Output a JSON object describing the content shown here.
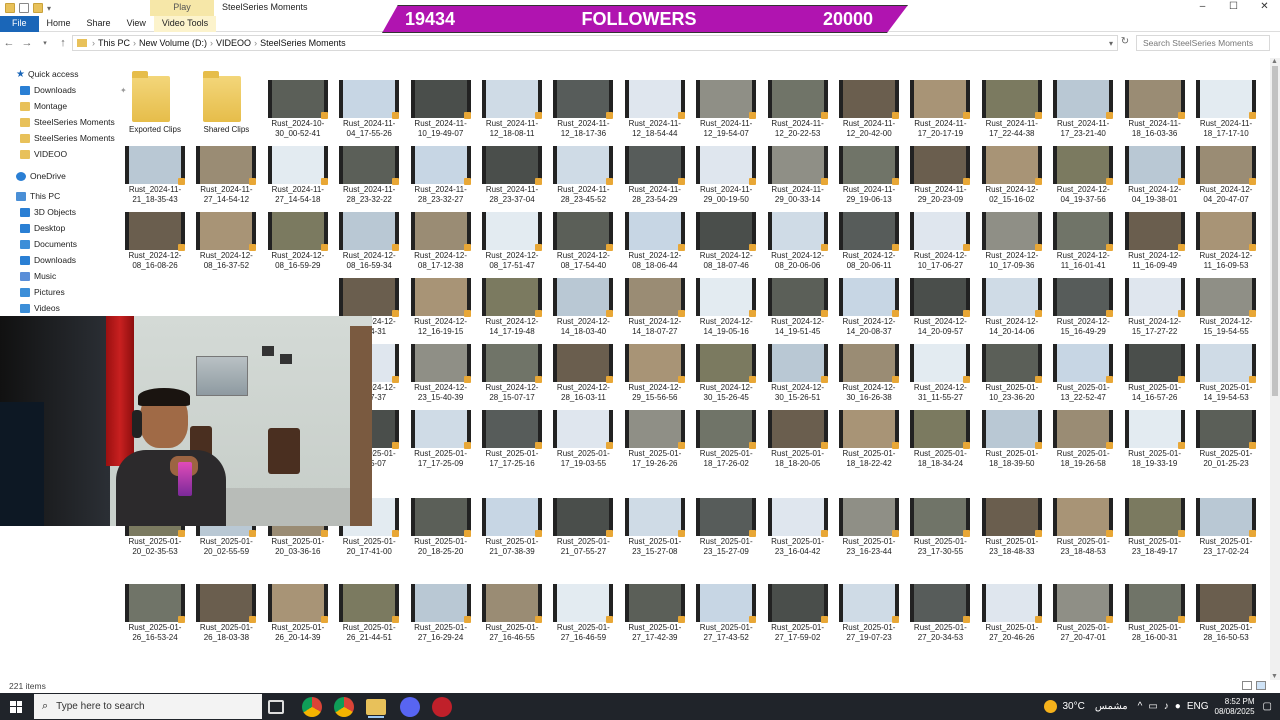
{
  "window": {
    "title": "SteelSeries Moments",
    "context_tab": "Play",
    "controls": [
      "–",
      "☐",
      "✕"
    ]
  },
  "ribbon": {
    "tabs": [
      "File",
      "Home",
      "Share",
      "View",
      "Video Tools"
    ]
  },
  "banner": {
    "current": "19434",
    "label": "FOLLOWERS",
    "goal": "20000",
    "color": "#b014b0"
  },
  "address": {
    "crumbs": [
      "This PC",
      "New Volume (D:)",
      "VIDEOO",
      "SteelSeries Moments"
    ],
    "search_placeholder": "Search SteelSeries Moments"
  },
  "sidebar": {
    "items": [
      {
        "label": "Quick access",
        "icon": "star-icon"
      },
      {
        "label": "Downloads",
        "icon": "download-icon",
        "pinned": true
      },
      {
        "label": "Montage",
        "icon": "folder-icon"
      },
      {
        "label": "SteelSeries Moments",
        "icon": "folder-icon"
      },
      {
        "label": "SteelSeries Moments",
        "icon": "folder-icon"
      },
      {
        "label": "VIDEOO",
        "icon": "folder-icon"
      },
      {
        "label": "OneDrive",
        "icon": "cloud-icon"
      },
      {
        "label": "This PC",
        "icon": "computer-icon"
      },
      {
        "label": "3D Objects",
        "icon": "cube-icon"
      },
      {
        "label": "Desktop",
        "icon": "desktop-icon"
      },
      {
        "label": "Documents",
        "icon": "documents-icon"
      },
      {
        "label": "Downloads",
        "icon": "download-icon"
      },
      {
        "label": "Music",
        "icon": "music-icon"
      },
      {
        "label": "Pictures",
        "icon": "pictures-icon"
      },
      {
        "label": "Videos",
        "icon": "videos-icon"
      }
    ]
  },
  "files": {
    "folders": [
      "Exported Clips",
      "Shared Clips"
    ],
    "rows": [
      [
        "Rust_2024-10-30_00-52-41",
        "Rust_2024-11-04_17-55-26",
        "Rust_2024-11-10_19-49-07",
        "Rust_2024-11-12_18-08-11",
        "Rust_2024-11-12_18-17-36",
        "Rust_2024-11-12_18-54-44",
        "Rust_2024-11-12_19-54-07",
        "Rust_2024-11-12_20-22-53",
        "Rust_2024-11-12_20-42-00",
        "Rust_2024-11-17_20-17-19",
        "Rust_2024-11-17_22-44-38",
        "Rust_2024-11-17_23-21-40",
        "Rust_2024-11-18_16-03-36",
        "Rust_2024-11-18_17-17-10"
      ],
      [
        "Rust_2024-11-21_18-35-43",
        "Rust_2024-11-27_14-54-12",
        "Rust_2024-11-27_14-54-18",
        "Rust_2024-11-28_23-32-22",
        "Rust_2024-11-28_23-32-27",
        "Rust_2024-11-28_23-37-04",
        "Rust_2024-11-28_23-45-52",
        "Rust_2024-11-28_23-54-29",
        "Rust_2024-11-29_00-19-50",
        "Rust_2024-11-29_00-33-14",
        "Rust_2024-11-29_19-06-13",
        "Rust_2024-11-29_20-23-09",
        "Rust_2024-12-02_15-16-02",
        "Rust_2024-12-04_19-37-56",
        "Rust_2024-12-04_19-38-01",
        "Rust_2024-12-04_20-47-07"
      ],
      [
        "Rust_2024-12-08_16-08-26",
        "Rust_2024-12-08_16-37-52",
        "Rust_2024-12-08_16-59-29",
        "Rust_2024-12-08_16-59-34",
        "Rust_2024-12-08_17-12-38",
        "Rust_2024-12-08_17-51-47",
        "Rust_2024-12-08_17-54-40",
        "Rust_2024-12-08_18-06-44",
        "Rust_2024-12-08_18-07-46",
        "Rust_2024-12-08_20-06-06",
        "Rust_2024-12-08_20-06-11",
        "Rust_2024-12-10_17-06-27",
        "Rust_2024-12-10_17-09-36",
        "Rust_2024-12-11_16-01-41",
        "Rust_2024-12-11_16-09-49",
        "Rust_2024-12-11_16-09-53"
      ],
      [
        "",
        "",
        "",
        "Rust_2024-12-12_14-31",
        "Rust_2024-12-12_16-19-15",
        "Rust_2024-12-14_17-19-48",
        "Rust_2024-12-14_18-03-40",
        "Rust_2024-12-14_18-07-27",
        "Rust_2024-12-14_19-05-16",
        "Rust_2024-12-14_19-51-45",
        "Rust_2024-12-14_20-08-37",
        "Rust_2024-12-14_20-09-57",
        "Rust_2024-12-14_20-14-06",
        "Rust_2024-12-15_16-49-29",
        "Rust_2024-12-15_17-27-22",
        "Rust_2024-12-15_19-54-55"
      ],
      [
        "",
        "",
        "",
        "Rust_2024-12-19_17-37",
        "Rust_2024-12-23_15-40-39",
        "Rust_2024-12-28_15-07-17",
        "Rust_2024-12-28_16-03-11",
        "Rust_2024-12-29_15-56-56",
        "Rust_2024-12-30_15-26-45",
        "Rust_2024-12-30_15-26-51",
        "Rust_2024-12-30_16-26-38",
        "Rust_2024-12-31_11-55-27",
        "Rust_2025-01-10_23-36-20",
        "Rust_2025-01-13_22-52-47",
        "Rust_2025-01-14_16-57-26",
        "Rust_2025-01-14_19-54-53"
      ],
      [
        "",
        "",
        "",
        "Rust_2025-01-17_15-07",
        "Rust_2025-01-17_17-25-09",
        "Rust_2025-01-17_17-25-16",
        "Rust_2025-01-17_19-03-55",
        "Rust_2025-01-17_19-26-26",
        "Rust_2025-01-18_17-26-02",
        "Rust_2025-01-18_18-20-05",
        "Rust_2025-01-18_18-22-42",
        "Rust_2025-01-18_18-34-24",
        "Rust_2025-01-18_18-39-50",
        "Rust_2025-01-18_19-26-58",
        "Rust_2025-01-18_19-33-19",
        "Rust_2025-01-20_01-25-23"
      ],
      [
        "Rust_2025-01-20_02-35-53",
        "Rust_2025-01-20_02-55-59",
        "Rust_2025-01-20_03-36-16",
        "Rust_2025-01-20_17-41-00",
        "Rust_2025-01-20_18-25-20",
        "Rust_2025-01-21_07-38-39",
        "Rust_2025-01-21_07-55-27",
        "Rust_2025-01-23_15-27-08",
        "Rust_2025-01-23_15-27-09",
        "Rust_2025-01-23_16-04-42",
        "Rust_2025-01-23_16-23-44",
        "Rust_2025-01-23_17-30-55",
        "Rust_2025-01-23_18-48-33",
        "Rust_2025-01-23_18-48-53",
        "Rust_2025-01-23_18-49-17",
        "Rust_2025-01-23_17-02-24"
      ],
      [
        "Rust_2025-01-26_16-53-24",
        "Rust_2025-01-26_18-03-38",
        "Rust_2025-01-26_20-14-39",
        "Rust_2025-01-26_21-44-51",
        "Rust_2025-01-27_16-29-24",
        "Rust_2025-01-27_16-46-55",
        "Rust_2025-01-27_16-46-59",
        "Rust_2025-01-27_17-42-39",
        "Rust_2025-01-27_17-43-52",
        "Rust_2025-01-27_17-59-02",
        "Rust_2025-01-27_19-07-23",
        "Rust_2025-01-27_20-34-53",
        "Rust_2025-01-27_20-46-26",
        "Rust_2025-01-27_20-47-01",
        "Rust_2025-01-28_16-00-31",
        "Rust_2025-01-28_16-50-53"
      ]
    ],
    "thumb_colors": [
      "#5b5f58",
      "#dfe6ee",
      "#7b7a60",
      "#c7d6e4",
      "#8f8f86",
      "#b9c8d4",
      "#4a4e4b",
      "#707468",
      "#9a8c74",
      "#cfdbe6",
      "#6a5e4e",
      "#e3ebf1",
      "#575c5a",
      "#a89476"
    ]
  },
  "status": {
    "item_count": "221 items"
  },
  "taskbar": {
    "search_placeholder": "Type here to search",
    "weather": "30°C",
    "weather_desc": "مشمس",
    "time": "8:52 PM",
    "date": "08/08/2025"
  }
}
